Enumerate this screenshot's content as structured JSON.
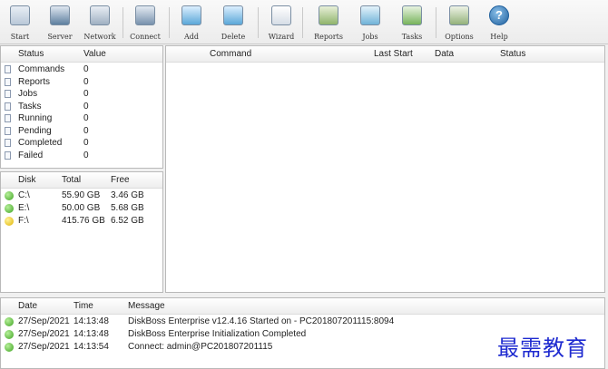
{
  "toolbar": {
    "buttons": [
      {
        "label": "Start",
        "icon": "start-icon"
      },
      {
        "label": "Server",
        "icon": "server-icon"
      },
      {
        "label": "Network",
        "icon": "network-icon"
      },
      {
        "label": "Connect",
        "icon": "connect-icon"
      },
      {
        "label": "Add",
        "icon": "add-folder-icon"
      },
      {
        "label": "Delete",
        "icon": "delete-folder-icon"
      },
      {
        "label": "Wizard",
        "icon": "wizard-icon"
      },
      {
        "label": "Reports",
        "icon": "reports-icon"
      },
      {
        "label": "Jobs",
        "icon": "jobs-icon"
      },
      {
        "label": "Tasks",
        "icon": "tasks-icon"
      },
      {
        "label": "Options",
        "icon": "options-icon"
      },
      {
        "label": "Help",
        "icon": "help-icon"
      }
    ]
  },
  "status_panel": {
    "headers": {
      "status": "Status",
      "value": "Value"
    },
    "rows": [
      {
        "status": "Commands",
        "value": "0"
      },
      {
        "status": "Reports",
        "value": "0"
      },
      {
        "status": "Jobs",
        "value": "0"
      },
      {
        "status": "Tasks",
        "value": "0"
      },
      {
        "status": "Running",
        "value": "0"
      },
      {
        "status": "Pending",
        "value": "0"
      },
      {
        "status": "Completed",
        "value": "0"
      },
      {
        "status": "Failed",
        "value": "0"
      }
    ]
  },
  "disk_panel": {
    "headers": {
      "disk": "Disk",
      "total": "Total",
      "free": "Free"
    },
    "rows": [
      {
        "disk": "C:\\",
        "total": "55.90 GB",
        "free": "3.46 GB",
        "status_color": "#3ea321"
      },
      {
        "disk": "E:\\",
        "total": "50.00 GB",
        "free": "5.68 GB",
        "status_color": "#3ea321"
      },
      {
        "disk": "F:\\",
        "total": "415.76 GB",
        "free": "6.52 GB",
        "status_color": "#e0b300"
      }
    ]
  },
  "command_panel": {
    "headers": {
      "command": "Command",
      "last_start": "Last Start",
      "data": "Data",
      "status": "Status"
    }
  },
  "log_panel": {
    "headers": {
      "date": "Date",
      "time": "Time",
      "message": "Message"
    },
    "rows": [
      {
        "date": "27/Sep/2021",
        "time": "14:13:48",
        "message": "DiskBoss Enterprise v12.4.16 Started on - PC201807201115:8094"
      },
      {
        "date": "27/Sep/2021",
        "time": "14:13:48",
        "message": "DiskBoss Enterprise Initialization Completed"
      },
      {
        "date": "27/Sep/2021",
        "time": "14:13:54",
        "message": "Connect: admin@PC201807201115"
      }
    ]
  },
  "watermark": "最需教育"
}
